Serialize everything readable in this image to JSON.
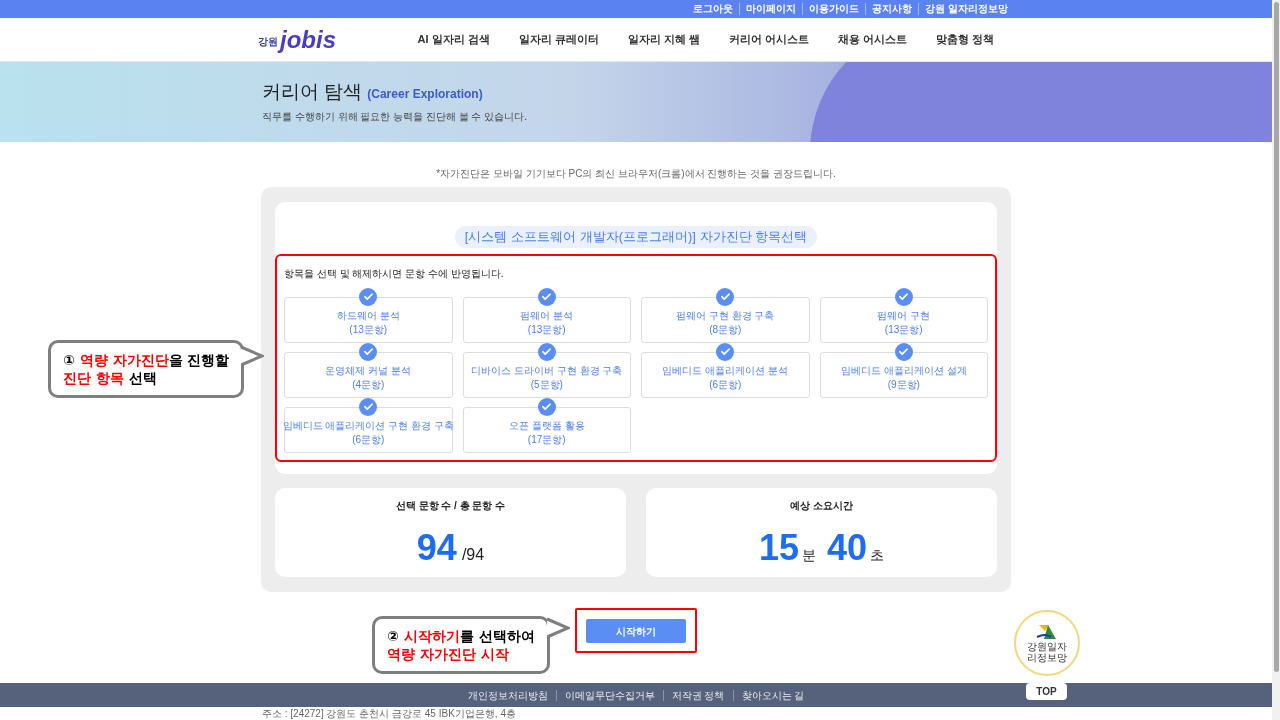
{
  "top_links": [
    "로그아웃",
    "마이페이지",
    "이용가이드",
    "공지사항",
    "강원 일자리정보망"
  ],
  "logo": {
    "region": "강원",
    "name": "jobis"
  },
  "nav": [
    "AI 일자리 검색",
    "일자리 큐레이터",
    "일자리 지혜 쌤",
    "커리어 어시스트",
    "채용 어시스트",
    "맞춤형 정책"
  ],
  "hero": {
    "title": "커리어 탐색",
    "subtitle": "(Career Exploration)",
    "description": "직무를 수행하기 위해 필요한 능력을 진단해 볼 수 있습니다."
  },
  "notice": "*자가진단은 모바일 기기보다 PC의 최신 브라우저(크롬)에서 진행하는 것을 권장드립니다.",
  "selection": {
    "title": "[시스템 소프트웨어 개발자(프로그래머)] 자가진단 항목선택",
    "hint": "항목을 선택 및 해제하시면 문항 수에 반영됩니다.",
    "items": [
      {
        "name": "하드웨어 분석",
        "count": "(13문항)",
        "checked": true
      },
      {
        "name": "펌웨어 분석",
        "count": "(13문항)",
        "checked": true
      },
      {
        "name": "펌웨어 구현 환경 구축",
        "count": "(8문항)",
        "checked": true
      },
      {
        "name": "펌웨어 구현",
        "count": "(13문항)",
        "checked": true
      },
      {
        "name": "운영체제 커널 분석",
        "count": "(4문항)",
        "checked": true
      },
      {
        "name": "디바이스 드라이버 구현 환경 구축",
        "count": "(5문항)",
        "checked": true
      },
      {
        "name": "임베디드 애플리케이션 분석",
        "count": "(6문항)",
        "checked": true
      },
      {
        "name": "임베디드 애플리케이션 설계",
        "count": "(9문항)",
        "checked": true
      },
      {
        "name": "임베디드 애플리케이션 구현 환경 구축",
        "count": "(6문항)",
        "checked": true
      },
      {
        "name": "오픈 플랫폼 활용",
        "count": "(17문항)",
        "checked": true
      }
    ]
  },
  "summary": {
    "questions": {
      "label": "선택 문항 수 / 총 문항 수",
      "selected": "94",
      "total": "/94"
    },
    "time": {
      "label": "예상 소요시간",
      "minutes": "15",
      "minutes_unit": "분",
      "seconds": "40",
      "seconds_unit": "초"
    }
  },
  "start_button": "시작하기",
  "callouts": [
    {
      "lines": [
        [
          {
            "text": "① ",
            "highlight": false
          },
          {
            "text": "역량 자가진단",
            "highlight": true
          },
          {
            "text": "을 진행할",
            "highlight": false
          }
        ],
        [
          {
            "text": "진단 항목",
            "highlight": true
          },
          {
            "text": " 선택",
            "highlight": false
          }
        ]
      ]
    },
    {
      "lines": [
        [
          {
            "text": "② ",
            "highlight": false
          },
          {
            "text": "시작하기",
            "highlight": true
          },
          {
            "text": "를 선택하여",
            "highlight": false
          }
        ],
        [
          {
            "text": "역량 자가진단 시작",
            "highlight": true
          }
        ]
      ]
    }
  ],
  "side_badge": "강원일자리정보망",
  "top_button": "TOP",
  "footer_links": [
    "개인정보처리방침",
    "이메일무단수집거부",
    "저작권 정책",
    "찾아오시는 길"
  ],
  "address": "주소 : [24272] 강원도 춘천시 금강로 45 IBK기업은행, 4층"
}
